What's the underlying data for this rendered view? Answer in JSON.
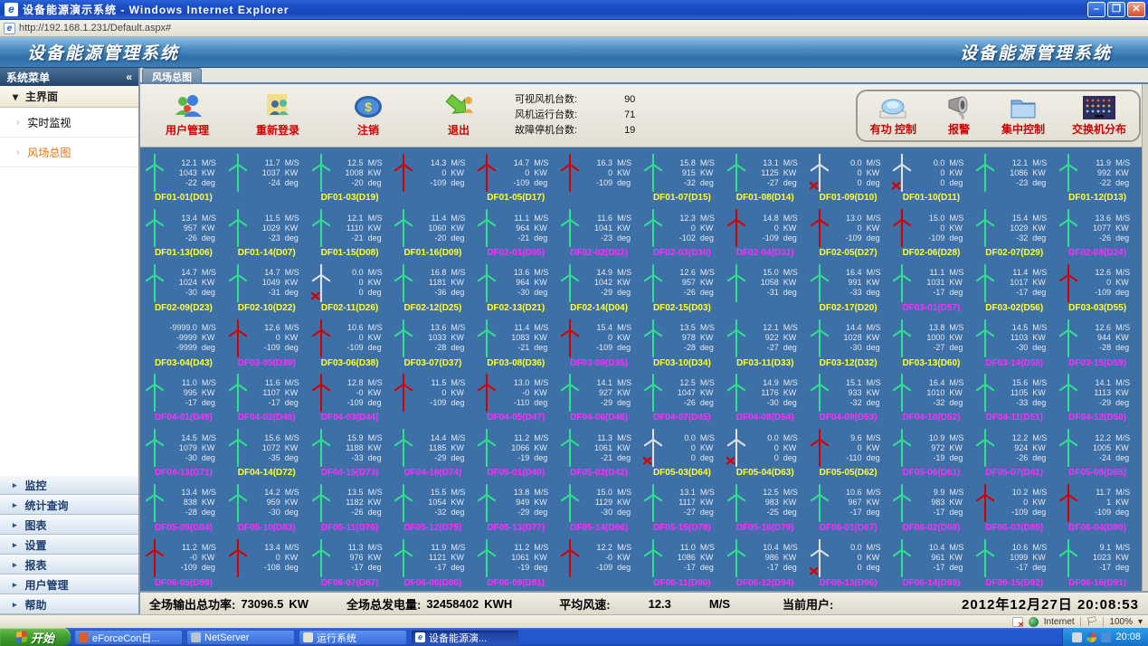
{
  "window": {
    "title": "设备能源演示系统 - Windows Internet Explorer",
    "url": "http://192.168.1.231/Default.aspx#",
    "buttons": {
      "minimize": "–",
      "restore": "❐",
      "close": "✕"
    }
  },
  "header": {
    "title_left": "设备能源管理系统",
    "title_right": "设备能源管理系统"
  },
  "sidebar": {
    "header": "系统菜单",
    "collapse": "«",
    "group_open": "主界面",
    "items": [
      {
        "label": "实时监视"
      },
      {
        "label": "风场总图"
      }
    ],
    "bottom_items": [
      "监控",
      "统计查询",
      "图表",
      "设置",
      "报表",
      "用户管理",
      "帮助"
    ]
  },
  "tab": "风场总图",
  "toolbar": {
    "buttons": [
      {
        "label": "用户管理"
      },
      {
        "label": "重新登录"
      },
      {
        "label": "注销"
      },
      {
        "label": "退出"
      }
    ],
    "stats": [
      {
        "label": "可视风机台数:",
        "value": "90"
      },
      {
        "label": "风机运行台数:",
        "value": "71"
      },
      {
        "label": "故障停机台数:",
        "value": "19"
      }
    ],
    "control_buttons": [
      {
        "label": "有功 控制"
      },
      {
        "label": "报警"
      },
      {
        "label": "集中控制"
      },
      {
        "label": "交换机分布"
      }
    ]
  },
  "grid": {
    "units": [
      "M/S",
      "KW",
      "deg"
    ],
    "turbines": [
      {
        "s": "12.1",
        "p": "1043",
        "d": "-22",
        "n": "DF01-01(D01)",
        "c": "y",
        "st": "run"
      },
      {
        "s": "11.7",
        "p": "1037",
        "d": "-24",
        "n": "",
        "c": "",
        "st": "run"
      },
      {
        "s": "12.5",
        "p": "1008",
        "d": "-20",
        "n": "DF01-03(D19)",
        "c": "y",
        "st": "run"
      },
      {
        "s": "14.3",
        "p": "0",
        "d": "-109",
        "n": "",
        "c": "",
        "st": "fault"
      },
      {
        "s": "14.7",
        "p": "0",
        "d": "-109",
        "n": "DF01-05(D17)",
        "c": "y",
        "st": "fault"
      },
      {
        "s": "16.3",
        "p": "0",
        "d": "-109",
        "n": "",
        "c": "",
        "st": "fault"
      },
      {
        "s": "15.8",
        "p": "915",
        "d": "-32",
        "n": "DF01-07(D15)",
        "c": "y",
        "st": "run"
      },
      {
        "s": "13.1",
        "p": "1125",
        "d": "-27",
        "n": "DF01-08(D14)",
        "c": "y",
        "st": "run"
      },
      {
        "s": "0.0",
        "p": "0",
        "d": "0",
        "n": "DF01-09(D10)",
        "c": "y",
        "st": "stop"
      },
      {
        "s": "0.0",
        "p": "0",
        "d": "0",
        "n": "DF01-10(D11)",
        "c": "y",
        "st": "stop"
      },
      {
        "s": "12.1",
        "p": "1086",
        "d": "-23",
        "n": "",
        "c": "",
        "st": "run"
      },
      {
        "s": "11.9",
        "p": "992",
        "d": "-22",
        "n": "DF01-12(D13)",
        "c": "y",
        "st": "run"
      },
      {
        "s": "13.4",
        "p": "957",
        "d": "-26",
        "n": "DF01-13(D06)",
        "c": "y",
        "st": "run"
      },
      {
        "s": "11.5",
        "p": "1029",
        "d": "-23",
        "n": "DF01-14(D07)",
        "c": "y",
        "st": "run"
      },
      {
        "s": "12.1",
        "p": "1110",
        "d": "-21",
        "n": "DF01-15(D08)",
        "c": "y",
        "st": "run"
      },
      {
        "s": "11.4",
        "p": "1060",
        "d": "-20",
        "n": "DF01-16(D09)",
        "c": "y",
        "st": "run"
      },
      {
        "s": "11.1",
        "p": "964",
        "d": "-21",
        "n": "DF02-01(D05)",
        "c": "m",
        "st": "run"
      },
      {
        "s": "11.6",
        "p": "1041",
        "d": "-23",
        "n": "DF02-02(D02)",
        "c": "m",
        "st": "run"
      },
      {
        "s": "12.3",
        "p": "0",
        "d": "-102",
        "n": "DF02-03(D30)",
        "c": "m",
        "st": "run"
      },
      {
        "s": "14.8",
        "p": "0",
        "d": "-109",
        "n": "DF02-04(D31)",
        "c": "m",
        "st": "fault"
      },
      {
        "s": "13.0",
        "p": "0",
        "d": "-109",
        "n": "DF02-05(D27)",
        "c": "y",
        "st": "fault"
      },
      {
        "s": "15.0",
        "p": "0",
        "d": "-109",
        "n": "DF02-06(D28)",
        "c": "y",
        "st": "fault"
      },
      {
        "s": "15.4",
        "p": "1029",
        "d": "-32",
        "n": "DF02-07(D29)",
        "c": "y",
        "st": "run"
      },
      {
        "s": "13.6",
        "p": "1077",
        "d": "-26",
        "n": "DF02-08(D24)",
        "c": "m",
        "st": "run"
      },
      {
        "s": "14.7",
        "p": "1024",
        "d": "-30",
        "n": "DF02-09(D23)",
        "c": "y",
        "st": "run"
      },
      {
        "s": "14.7",
        "p": "1049",
        "d": "-31",
        "n": "DF02-10(D22)",
        "c": "y",
        "st": "run"
      },
      {
        "s": "0.0",
        "p": "0",
        "d": "0",
        "n": "DF02-11(D26)",
        "c": "y",
        "st": "stop"
      },
      {
        "s": "16.8",
        "p": "1181",
        "d": "-36",
        "n": "DF02-12(D25)",
        "c": "y",
        "st": "run"
      },
      {
        "s": "13.6",
        "p": "964",
        "d": "-30",
        "n": "DF02-13(D21)",
        "c": "y",
        "st": "run"
      },
      {
        "s": "14.9",
        "p": "1042",
        "d": "-29",
        "n": "DF02-14(D04)",
        "c": "y",
        "st": "run"
      },
      {
        "s": "12.6",
        "p": "957",
        "d": "-26",
        "n": "DF02-15(D03)",
        "c": "y",
        "st": "run"
      },
      {
        "s": "15.0",
        "p": "1058",
        "d": "-31",
        "n": "",
        "c": "",
        "st": "run"
      },
      {
        "s": "16.4",
        "p": "991",
        "d": "-33",
        "n": "DF02-17(D20)",
        "c": "y",
        "st": "run"
      },
      {
        "s": "11.1",
        "p": "1031",
        "d": "-17",
        "n": "DF03-01(D57)",
        "c": "m",
        "st": "run"
      },
      {
        "s": "11.4",
        "p": "1017",
        "d": "-17",
        "n": "DF03-02(D56)",
        "c": "y",
        "st": "run"
      },
      {
        "s": "12.6",
        "p": "0",
        "d": "-109",
        "n": "DF03-03(D55)",
        "c": "y",
        "st": "fault"
      },
      {
        "s": "-9999.0",
        "p": "-9999",
        "d": "-9999",
        "n": "DF03-04(D43)",
        "c": "y",
        "st": "none"
      },
      {
        "s": "12.6",
        "p": "0",
        "d": "-109",
        "n": "DF03-05(D39)",
        "c": "m",
        "st": "fault"
      },
      {
        "s": "10.6",
        "p": "0",
        "d": "-109",
        "n": "DF03-06(D38)",
        "c": "y",
        "st": "fault"
      },
      {
        "s": "13.6",
        "p": "1033",
        "d": "-28",
        "n": "DF03-07(D37)",
        "c": "y",
        "st": "run"
      },
      {
        "s": "11.4",
        "p": "1083",
        "d": "-21",
        "n": "DF03-08(D36)",
        "c": "y",
        "st": "run"
      },
      {
        "s": "15.4",
        "p": "0",
        "d": "-109",
        "n": "DF03-09(D35)",
        "c": "m",
        "st": "fault"
      },
      {
        "s": "13.5",
        "p": "978",
        "d": "-28",
        "n": "DF03-10(D34)",
        "c": "y",
        "st": "run"
      },
      {
        "s": "12.1",
        "p": "922",
        "d": "-27",
        "n": "DF03-11(D33)",
        "c": "y",
        "st": "run"
      },
      {
        "s": "14.4",
        "p": "1028",
        "d": "-30",
        "n": "DF03-12(D32)",
        "c": "y",
        "st": "run"
      },
      {
        "s": "13.8",
        "p": "1000",
        "d": "-27",
        "n": "DF03-13(D60)",
        "c": "y",
        "st": "run"
      },
      {
        "s": "14.5",
        "p": "1103",
        "d": "-30",
        "n": "DF03-14(D58)",
        "c": "m",
        "st": "run"
      },
      {
        "s": "12.6",
        "p": "944",
        "d": "-28",
        "n": "DF03-15(D59)",
        "c": "m",
        "st": "run"
      },
      {
        "s": "11.0",
        "p": "995",
        "d": "-17",
        "n": "DF04-01(D49)",
        "c": "m",
        "st": "run"
      },
      {
        "s": "11.6",
        "p": "1107",
        "d": "-17",
        "n": "DF04-02(D48)",
        "c": "m",
        "st": "run"
      },
      {
        "s": "12.8",
        "p": "-0",
        "d": "-109",
        "n": "DF04-03(D44)",
        "c": "m",
        "st": "fault"
      },
      {
        "s": "11.5",
        "p": "0",
        "d": "-109",
        "n": "",
        "c": "",
        "st": "fault"
      },
      {
        "s": "13.0",
        "p": "-0",
        "d": "-110",
        "n": "DF04-05(D47)",
        "c": "m",
        "st": "fault"
      },
      {
        "s": "14.1",
        "p": "927",
        "d": "-29",
        "n": "DF04-06(D46)",
        "c": "m",
        "st": "run"
      },
      {
        "s": "12.5",
        "p": "1047",
        "d": "-26",
        "n": "DF04-07(D45)",
        "c": "m",
        "st": "run"
      },
      {
        "s": "14.9",
        "p": "1176",
        "d": "-30",
        "n": "DF04-08(D54)",
        "c": "m",
        "st": "run"
      },
      {
        "s": "15.1",
        "p": "933",
        "d": "-32",
        "n": "DF04-09(D53)",
        "c": "m",
        "st": "run"
      },
      {
        "s": "16.4",
        "p": "1010",
        "d": "-32",
        "n": "DF04-10(D52)",
        "c": "m",
        "st": "run"
      },
      {
        "s": "15.6",
        "p": "1105",
        "d": "-33",
        "n": "DF04-11(D51)",
        "c": "m",
        "st": "run"
      },
      {
        "s": "14.1",
        "p": "1113",
        "d": "-29",
        "n": "DF04-12(D50)",
        "c": "m",
        "st": "run"
      },
      {
        "s": "14.5",
        "p": "1079",
        "d": "-30",
        "n": "DF04-13(D71)",
        "c": "m",
        "st": "run"
      },
      {
        "s": "15.6",
        "p": "1072",
        "d": "-35",
        "n": "DF04-14(D72)",
        "c": "y",
        "st": "run"
      },
      {
        "s": "15.9",
        "p": "1188",
        "d": "-33",
        "n": "DF04-15(D73)",
        "c": "m",
        "st": "run"
      },
      {
        "s": "14.4",
        "p": "1185",
        "d": "-29",
        "n": "DF04-16(D74)",
        "c": "m",
        "st": "run"
      },
      {
        "s": "11.2",
        "p": "1066",
        "d": "-19",
        "n": "DF05-01(D40)",
        "c": "m",
        "st": "run"
      },
      {
        "s": "11.3",
        "p": "1061",
        "d": "-21",
        "n": "DF05-02(D42)",
        "c": "m",
        "st": "run"
      },
      {
        "s": "0.0",
        "p": "0",
        "d": "0",
        "n": "DF05-03(D64)",
        "c": "y",
        "st": "stop"
      },
      {
        "s": "0.0",
        "p": "0",
        "d": "0",
        "n": "DF05-04(D63)",
        "c": "y",
        "st": "stop"
      },
      {
        "s": "9.6",
        "p": "0",
        "d": "-110",
        "n": "DF05-05(D62)",
        "c": "y",
        "st": "fault"
      },
      {
        "s": "10.9",
        "p": "972",
        "d": "-19",
        "n": "DF05-06(D61)",
        "c": "m",
        "st": "run"
      },
      {
        "s": "12.2",
        "p": "924",
        "d": "-26",
        "n": "DF05-07(D41)",
        "c": "m",
        "st": "run"
      },
      {
        "s": "12.2",
        "p": "1005",
        "d": "-24",
        "n": "DF05-08(D65)",
        "c": "m",
        "st": "run"
      },
      {
        "s": "13.4",
        "p": "838",
        "d": "-28",
        "n": "DF05-09(D84)",
        "c": "m",
        "st": "run"
      },
      {
        "s": "14.2",
        "p": "959",
        "d": "-30",
        "n": "DF05-10(D83)",
        "c": "m",
        "st": "run"
      },
      {
        "s": "13.5",
        "p": "1182",
        "d": "-26",
        "n": "DF05-11(D76)",
        "c": "m",
        "st": "run"
      },
      {
        "s": "15.5",
        "p": "1054",
        "d": "-32",
        "n": "DF05-12(D75)",
        "c": "m",
        "st": "run"
      },
      {
        "s": "13.8",
        "p": "949",
        "d": "-29",
        "n": "DF05-13(D77)",
        "c": "m",
        "st": "run"
      },
      {
        "s": "15.0",
        "p": "1129",
        "d": "-30",
        "n": "DF05-14(D66)",
        "c": "m",
        "st": "run"
      },
      {
        "s": "13.1",
        "p": "1117",
        "d": "-27",
        "n": "DF05-15(D78)",
        "c": "m",
        "st": "run"
      },
      {
        "s": "12.5",
        "p": "983",
        "d": "-25",
        "n": "DF05-16(D79)",
        "c": "m",
        "st": "run"
      },
      {
        "s": "10.6",
        "p": "967",
        "d": "-17",
        "n": "DF06-01(D67)",
        "c": "m",
        "st": "run"
      },
      {
        "s": "9.9",
        "p": "983",
        "d": "-17",
        "n": "DF06-02(D68)",
        "c": "m",
        "st": "run"
      },
      {
        "s": "10.2",
        "p": "0",
        "d": "-109",
        "n": "DF06-03(D85)",
        "c": "m",
        "st": "fault"
      },
      {
        "s": "11.7",
        "p": "1",
        "d": "-109",
        "n": "DF06-04(D80)",
        "c": "m",
        "st": "fault"
      },
      {
        "s": "11.2",
        "p": "-0",
        "d": "-109",
        "n": "DF06-05(D89)",
        "c": "m",
        "st": "fault"
      },
      {
        "s": "13.4",
        "p": "0",
        "d": "-108",
        "n": "",
        "c": "",
        "st": "fault"
      },
      {
        "s": "11.3",
        "p": "976",
        "d": "-17",
        "n": "DF06-07(D87)",
        "c": "m",
        "st": "run"
      },
      {
        "s": "11.9",
        "p": "1121",
        "d": "-17",
        "n": "DF06-08(D86)",
        "c": "m",
        "st": "run"
      },
      {
        "s": "11.2",
        "p": "1061",
        "d": "-19",
        "n": "DF06-09(D81)",
        "c": "m",
        "st": "run"
      },
      {
        "s": "12.2",
        "p": "-0",
        "d": "-109",
        "n": "",
        "c": "",
        "st": "fault"
      },
      {
        "s": "11.0",
        "p": "1086",
        "d": "-17",
        "n": "DF06-11(D90)",
        "c": "m",
        "st": "run"
      },
      {
        "s": "10.4",
        "p": "986",
        "d": "-17",
        "n": "DF06-12(D94)",
        "c": "m",
        "st": "run"
      },
      {
        "s": "0.0",
        "p": "0",
        "d": "0",
        "n": "DF06-13(D96)",
        "c": "m",
        "st": "stop"
      },
      {
        "s": "10.4",
        "p": "961",
        "d": "-17",
        "n": "DF06-14(D93)",
        "c": "m",
        "st": "run"
      },
      {
        "s": "10.6",
        "p": "1099",
        "d": "-17",
        "n": "DF06-15(D92)",
        "c": "m",
        "st": "run"
      },
      {
        "s": "9.1",
        "p": "1023",
        "d": "-17",
        "n": "DF06-16(D91)",
        "c": "m",
        "st": "run"
      }
    ]
  },
  "statusbar": {
    "items": [
      {
        "label": "全场输出总功率:",
        "value": "73096.5",
        "unit": "KW"
      },
      {
        "label": "全场总发电量:",
        "value": "32458402",
        "unit": "KWH"
      },
      {
        "label": "平均风速:",
        "value": "12.3",
        "unit": "M/S"
      },
      {
        "label": "当前用户:",
        "value": ""
      }
    ],
    "datetime": "2012年12月27日  20:08:53"
  },
  "ie_status": {
    "zone": "Internet",
    "zoom": "100%"
  },
  "taskbar": {
    "start": "开始",
    "tasks": [
      "eForceCon日...",
      "NetServer",
      "运行系统",
      "设备能源演..."
    ],
    "active_task": 3,
    "tray_time": "20:08"
  },
  "colors": {
    "grid_bg": "#3E70A8",
    "run": "#2FE08E",
    "fault": "#D40000",
    "stop": "#E2E2E2",
    "label_yellow": "#FFFF2E",
    "label_magenta": "#FF2BFF"
  }
}
